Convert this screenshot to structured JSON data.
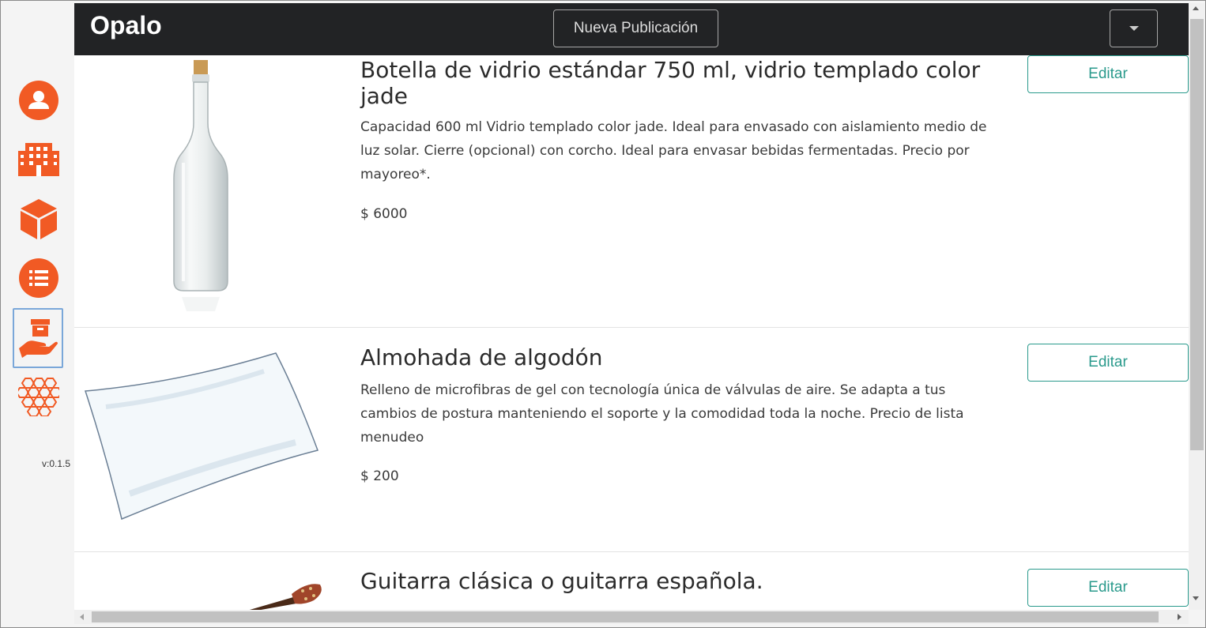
{
  "app": {
    "title": "Opalo",
    "version": "v:0.1.5"
  },
  "navbar": {
    "new_post_label": "Nueva Publicación",
    "dropdown_icon": "caret-down-icon"
  },
  "sidebar": {
    "accent_color": "#f15a24",
    "items": [
      {
        "icon": "user-icon"
      },
      {
        "icon": "building-icon"
      },
      {
        "icon": "box-icon"
      },
      {
        "icon": "list-icon"
      },
      {
        "icon": "hand-holding-box-icon",
        "active": true
      },
      {
        "icon": "honeycomb-icon"
      }
    ]
  },
  "products": [
    {
      "title": "Botella de vidrio estándar 750 ml, vidrio templado color jade",
      "description": "Capacidad 600 ml Vidrio templado color jade. Ideal para envasado con aislamiento medio de luz solar. Cierre (opcional) con corcho. Ideal para envasar bebidas fermentadas. Precio por mayoreo*.",
      "price": "$ 6000",
      "edit_label": "Editar",
      "image": "glass-bottle"
    },
    {
      "title": "Almohada de algodón",
      "description": "Relleno de microfibras de gel con tecnología única de válvulas de aire. Se adapta a tus cambios de postura manteniendo el soporte y la comodidad toda la noche. Precio de lista menudeo",
      "price": "$ 200",
      "edit_label": "Editar",
      "image": "pillow"
    },
    {
      "title": "Guitarra clásica o guitarra española.",
      "description": "",
      "price": "",
      "edit_label": "Editar",
      "image": "guitar"
    }
  ],
  "colors": {
    "navbar": "#222325",
    "edit_button": "#2a9a8c"
  }
}
